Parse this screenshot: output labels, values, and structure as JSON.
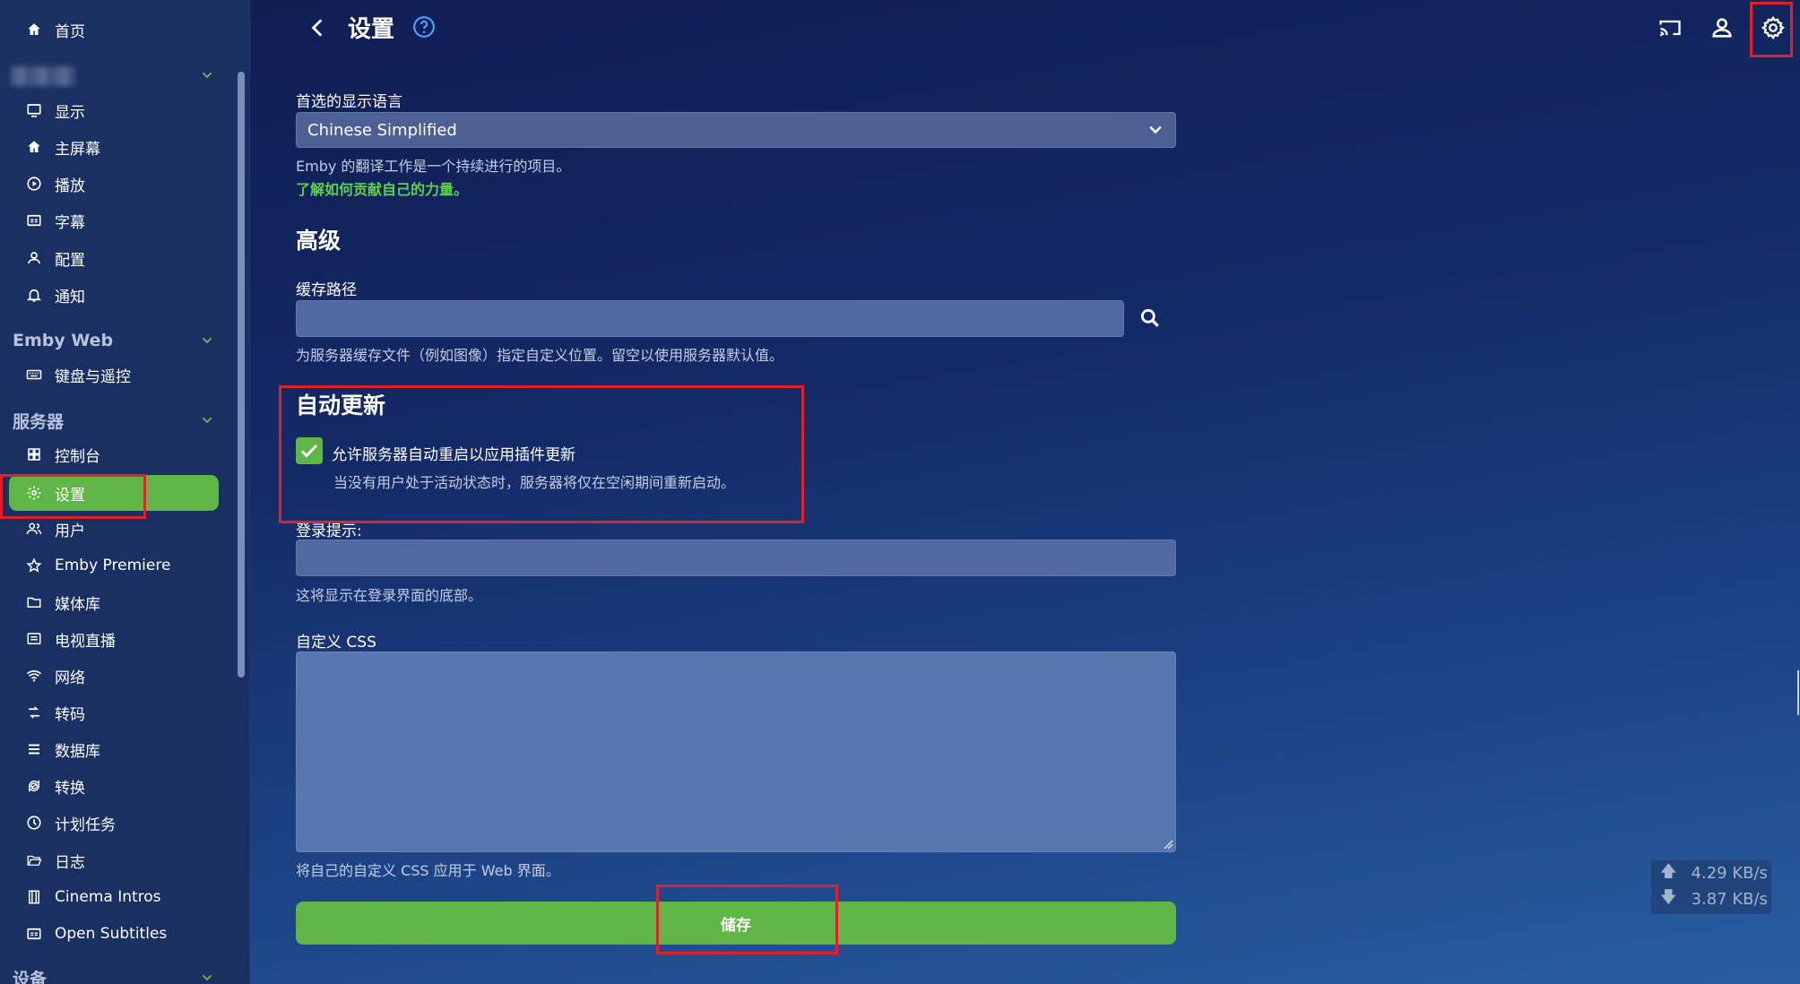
{
  "sidebar": {
    "home": "首页",
    "user_section_items": [
      "显示",
      "主屏幕",
      "播放",
      "字幕",
      "配置",
      "通知"
    ],
    "emby_web_title": "Emby Web",
    "emby_web_items": [
      "键盘与遥控"
    ],
    "server_title": "服务器",
    "server_items": [
      "控制台",
      "设置",
      "用户",
      "Emby Premiere",
      "媒体库",
      "电视直播",
      "网络",
      "转码",
      "数据库",
      "转换",
      "计划任务",
      "日志",
      "Cinema Intros",
      "Open Subtitles"
    ],
    "devices_title": "设备",
    "active_item": "设置"
  },
  "header": {
    "title": "设置",
    "icons": [
      "back-icon",
      "help-icon",
      "cast-icon",
      "user-icon",
      "settings-icon"
    ]
  },
  "form": {
    "language_label": "首选的显示语言",
    "language_value": "Chinese Simplified",
    "language_help": "Emby 的翻译工作是一个持续进行的项目。",
    "language_link": "了解如何贡献自己的力量。",
    "advanced_heading": "高级",
    "cache_label": "缓存路径",
    "cache_value": "",
    "cache_help": "为服务器缓存文件（例如图像）指定自定义位置。留空以使用服务器默认值。",
    "auto_update_heading": "自动更新",
    "auto_restart_label": "允许服务器自动重启以应用插件更新",
    "auto_restart_checked": true,
    "auto_restart_help": "当没有用户处于活动状态时，服务器将仅在空闲期间重新启动。",
    "login_hint_label": "登录提示:",
    "login_hint_value": "",
    "login_hint_help": "这将显示在登录界面的底部。",
    "custom_css_label": "自定义 CSS",
    "custom_css_value": "",
    "custom_css_help": "将自己的自定义 CSS 应用于 Web 界面。",
    "save_label": "储存"
  },
  "network_speed": {
    "upload": "4.29 KB/s",
    "download": "3.87 KB/s"
  },
  "colors": {
    "accent": "#5fb646",
    "annotation": "#e0212b",
    "link": "#5fd04e"
  }
}
